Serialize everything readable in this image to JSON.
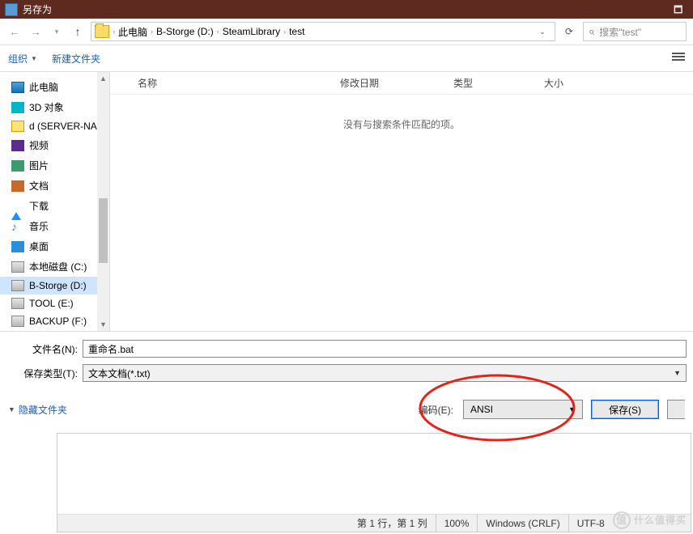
{
  "title": "另存为",
  "breadcrumbs": [
    "此电脑",
    "B-Storge (D:)",
    "SteamLibrary",
    "test"
  ],
  "search": {
    "placeholder": "搜索\"test\""
  },
  "toolbar": {
    "organize": "组织",
    "new_folder": "新建文件夹"
  },
  "tree": {
    "items": [
      {
        "icon": "pc",
        "label": "此电脑"
      },
      {
        "icon": "3d",
        "label": "3D 对象"
      },
      {
        "icon": "nas",
        "label": "d (SERVER-NAS"
      },
      {
        "icon": "video",
        "label": "视频"
      },
      {
        "icon": "pic",
        "label": "图片"
      },
      {
        "icon": "doc",
        "label": "文档"
      },
      {
        "icon": "dl",
        "label": "下载"
      },
      {
        "icon": "music",
        "label": "音乐"
      },
      {
        "icon": "desk",
        "label": "桌面"
      },
      {
        "icon": "disk",
        "label": "本地磁盘 (C:)"
      },
      {
        "icon": "disk",
        "label": "B-Storge (D:)",
        "selected": true
      },
      {
        "icon": "disk",
        "label": "TOOL (E:)"
      },
      {
        "icon": "disk",
        "label": "BACKUP (F:)"
      }
    ]
  },
  "columns": {
    "name": "名称",
    "modified": "修改日期",
    "type": "类型",
    "size": "大小"
  },
  "empty_message": "没有与搜索条件匹配的项。",
  "fields": {
    "filename_label": "文件名(N):",
    "filename_value": "重命名.bat",
    "type_label": "保存类型(T):",
    "type_value": "文本文档(*.txt)"
  },
  "bottom": {
    "hide_folders": "隐藏文件夹",
    "encoding_label": "编码(E):",
    "encoding_value": "ANSI",
    "save": "保存(S)"
  },
  "notepad_status": {
    "pos": "第 1 行，第 1 列",
    "zoom": "100%",
    "eol": "Windows (CRLF)",
    "enc": "UTF-8"
  },
  "watermark": "什么值得买"
}
